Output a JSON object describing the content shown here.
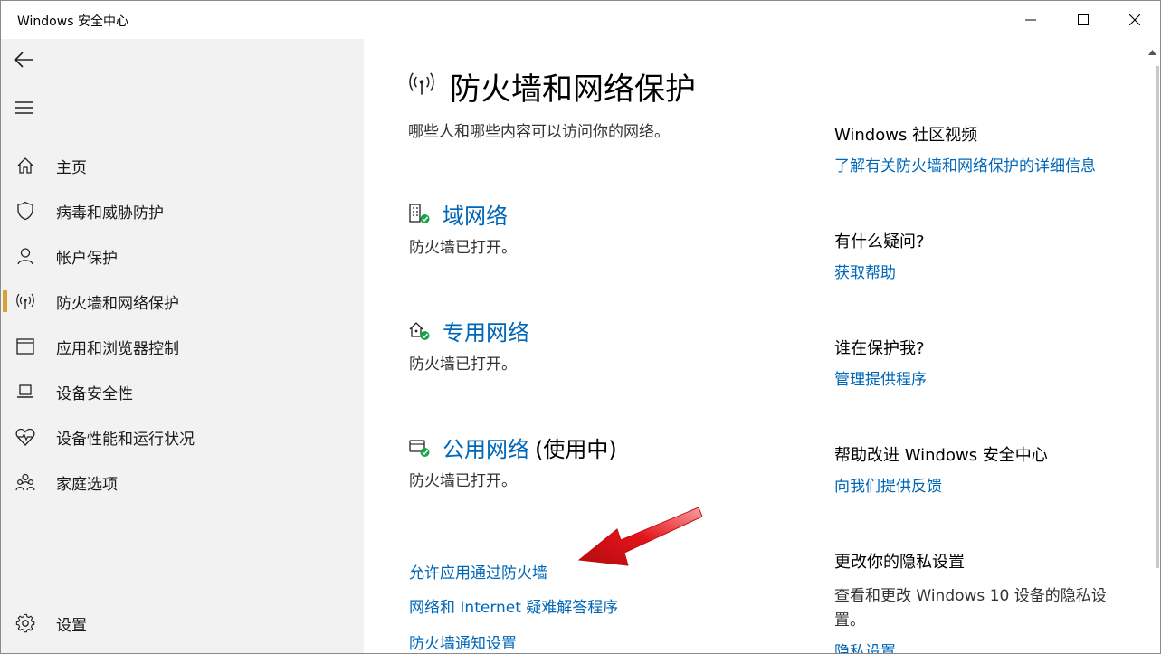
{
  "window": {
    "title": "Windows 安全中心"
  },
  "sidebar": {
    "items": [
      {
        "label": "主页",
        "icon": "home-icon"
      },
      {
        "label": "病毒和威胁防护",
        "icon": "shield-icon"
      },
      {
        "label": "帐户保护",
        "icon": "person-icon"
      },
      {
        "label": "防火墙和网络保护",
        "icon": "antenna-icon",
        "active": true
      },
      {
        "label": "应用和浏览器控制",
        "icon": "browser-window-icon"
      },
      {
        "label": "设备安全性",
        "icon": "laptop-icon"
      },
      {
        "label": "设备性能和运行状况",
        "icon": "heart-pulse-icon"
      },
      {
        "label": "家庭选项",
        "icon": "family-icon"
      }
    ],
    "settings_label": "设置"
  },
  "main": {
    "title": "防火墙和网络保护",
    "subtitle": "哪些人和哪些内容可以访问你的网络。",
    "networks": [
      {
        "name": "域网络",
        "suffix": "",
        "status": "防火墙已打开。",
        "icon": "domain-network-icon"
      },
      {
        "name": "专用网络",
        "suffix": "",
        "status": "防火墙已打开。",
        "icon": "private-network-icon"
      },
      {
        "name": "公用网络",
        "suffix": "(使用中)",
        "status": "防火墙已打开。",
        "icon": "public-network-icon"
      }
    ],
    "links": [
      "允许应用通过防火墙",
      "网络和 Internet 疑难解答程序",
      "防火墙通知设置"
    ]
  },
  "right": {
    "community_head": "Windows 社区视频",
    "community_link": "了解有关防火墙和网络保护的详细信息",
    "question_head": "有什么疑问?",
    "question_link": "获取帮助",
    "protect_head": "谁在保护我?",
    "protect_link": "管理提供程序",
    "improve_head": "帮助改进 Windows 安全中心",
    "improve_link": "向我们提供反馈",
    "privacy_head": "更改你的隐私设置",
    "privacy_text": "查看和更改 Windows 10 设备的隐私设置。",
    "privacy_link": "隐私设置"
  },
  "colors": {
    "accent": "#0067b8",
    "active_marker": "#d4a33a",
    "ok_badge": "#16a34a",
    "annotation_arrow": "#e3141b"
  }
}
